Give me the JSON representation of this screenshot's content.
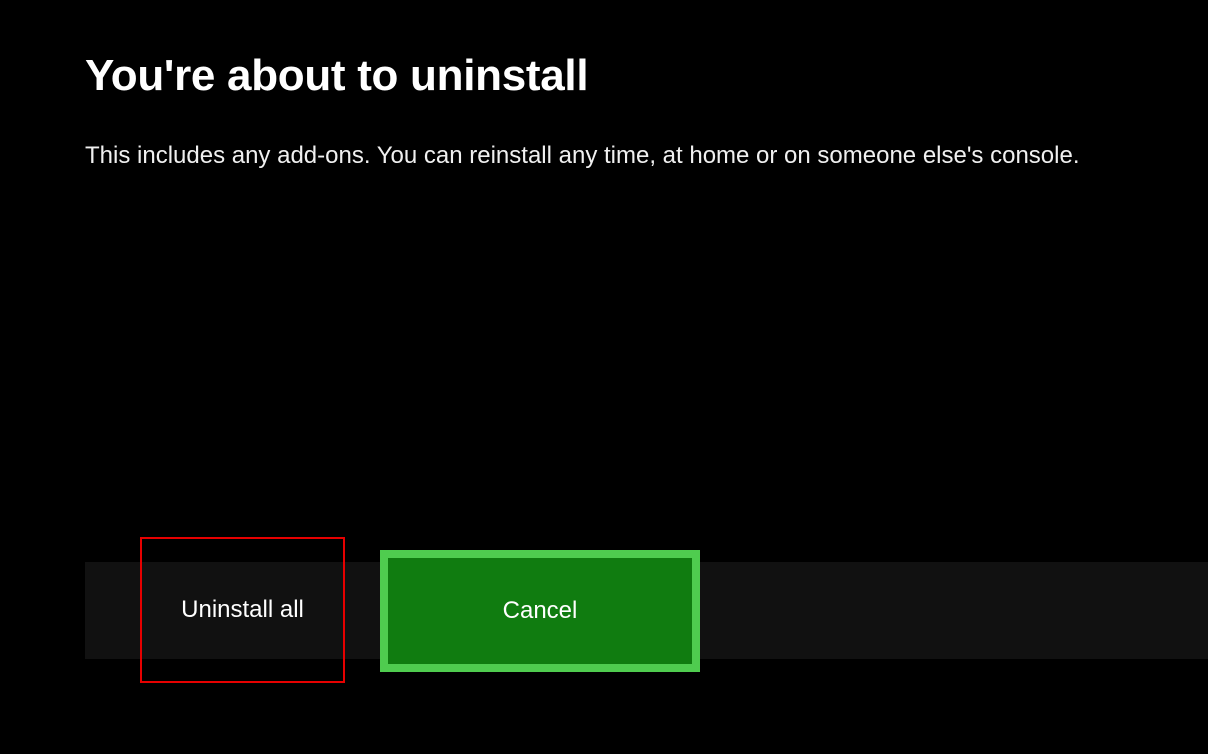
{
  "dialog": {
    "title": "You're about to uninstall",
    "description": "This includes any add-ons. You can reinstall any time, at home or on someone else's console."
  },
  "buttons": {
    "uninstall_label": "Uninstall all",
    "cancel_label": "Cancel"
  }
}
